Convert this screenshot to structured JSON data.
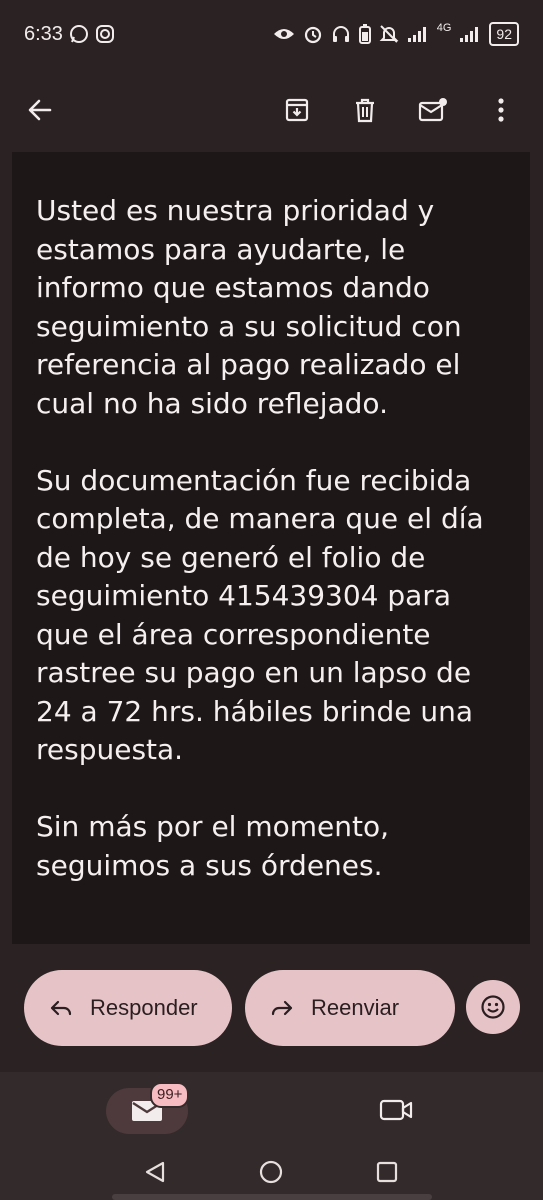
{
  "status_bar": {
    "time": "6:33",
    "network": "4G",
    "battery": "92"
  },
  "app_bar": {
    "icons": [
      "back-arrow-icon",
      "archive-icon",
      "delete-icon",
      "mark-unread-icon",
      "more-vert-icon"
    ]
  },
  "email": {
    "paragraphs": [
      "Usted es nuestra prioridad y estamos para ayudarte, le informo que estamos dando seguimiento a su solicitud con referencia al pago realizado el cual no ha sido reflejado.",
      "Su documentación fue recibida completa, de manera que el día de hoy se generó el folio de seguimiento 415439304 para que el área correspondiente rastree su pago en un lapso de 24 a 72 hrs. hábiles brinde una respuesta.",
      "Sin más por el momento, seguimos a sus órdenes."
    ]
  },
  "actions": {
    "reply": "Responder",
    "forward": "Reenviar"
  },
  "bottom_nav": {
    "mail_badge": "99+"
  },
  "colors": {
    "background": "#2a2223",
    "content_background": "#1d1718",
    "pill": "#e6c3c7",
    "badge": "#f7bcc1"
  }
}
